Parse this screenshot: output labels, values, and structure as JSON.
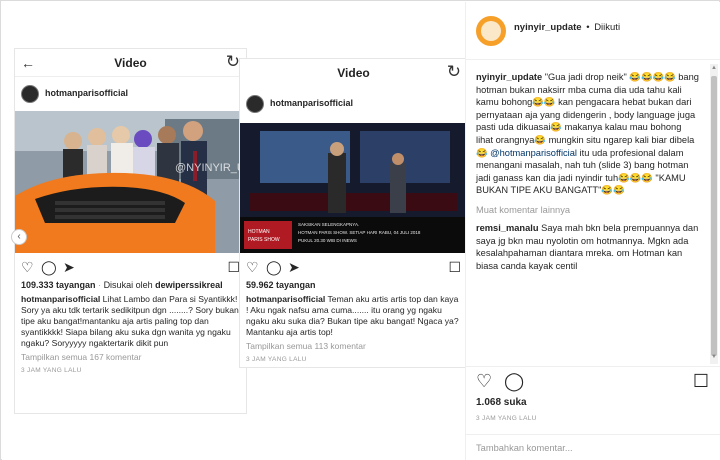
{
  "post": {
    "author": "nyinyir_update",
    "follow_status": "Diikuti",
    "views": "1.068 suka",
    "time": "3 JAM YANG LALU",
    "add_comment_placeholder": "Tambahkan komentar..."
  },
  "caption": {
    "username": "nyinyir_update",
    "text": "\"Gua jadi drop neik\" 😂😂😂😂 bang hotman bukan naksirr mba cuma dia uda tahu kali kamu bohong😂😂 kan pengacara hebat bukan dari pernyataan aja yang didengerin , body language juga pasti uda dikuasai😂 makanya kalau mau bohong lihat orangnya😂 mungkin situ ngarep kali biar dibela😂 ",
    "mention": "@hotmanparisofficial",
    "text2": " itu uda profesional dalam menangani masalah, nah tuh (slide 3) bang hotman jadi ganass kan dia jadi nyindir tuh😂😂😂 \"KAMU BUKAN TIPE AKU BANGATT\"😂😂"
  },
  "load_more": "Muat komentar lainnya",
  "comment2": {
    "username": "remsi_manalu",
    "text": "Saya mah bkn bela prempuannya dan saya jg bkn mau nyolotin om hotmannya. Mgkn ada kesalahpahaman diantara mreka. om Hotman kan biasa canda kayak centil"
  },
  "shot1": {
    "title": "Video",
    "username": "hotmanparisofficial",
    "views": "109.333 tayangan",
    "liked_by_prefix": "Disukai oleh",
    "liked_by_user": "dewiperssikreal",
    "caption_user": "hotmanparisofficial",
    "caption_text": "Lihat Lambo dan Para si Syantikkk! Sory ya aku tdk tertarik sedikitpun dgn ........? Sory bukan tipe aku bangat!mantanku aja artis paling top dan syantikkkk! Siapa bilang aku suka dgn wanita yg ngaku ngaku? Soryyyyy ngaktertarik dikit pun",
    "more_comments": "Tampilkan semua 167 komentar",
    "time": "3 JAM YANG LALU",
    "watermark": "@NYINYIR_UPDATE"
  },
  "shot2": {
    "title": "Video",
    "username": "hotmanparisofficial",
    "views": "59.962 tayangan",
    "caption_user": "hotmanparisofficial",
    "caption_text": "Teman aku artis artis top dan kaya ! Aku ngak nafsu ama cuma....... itu orang yg ngaku ngaku aku suka dia? Bukan tipe aku bangat! Ngaca ya?Mantanku aja artis top!",
    "more_comments": "Tampilkan semua 113 komentar",
    "time": "3 JAM YANG LALU",
    "tv_caption": "SAKSIKAN SELENGKAPNYA. HOTMAN PARIS SHOW. SETIAP HARI RABU, 04 JULI 2018 PUKUL 20.30 WIB DI INEWS",
    "tv_logo": "HOTMAN PARIS SHOW"
  },
  "colors": {
    "accent_link": "#003569",
    "muted": "#999999",
    "border": "#dbdbdb"
  }
}
